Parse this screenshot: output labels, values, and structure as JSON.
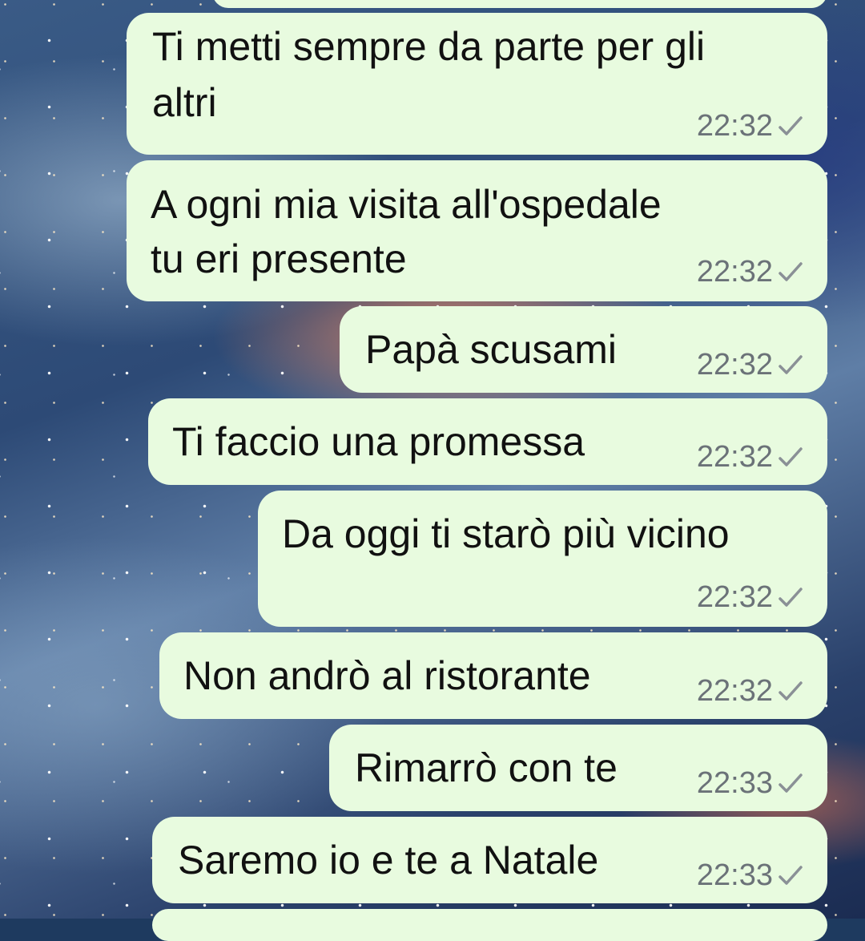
{
  "messages": [
    {
      "lines": [
        "",
        ""
      ],
      "time": "",
      "status_icon": "check-icon"
    },
    {
      "lines": [
        "Ti metti sempre da parte per gli",
        "altri"
      ],
      "time": "22:32",
      "status_icon": "check-icon"
    },
    {
      "lines": [
        "A ogni mia visita all'ospedale",
        "tu eri presente"
      ],
      "time": "22:32",
      "status_icon": "check-icon"
    },
    {
      "lines": [
        "Papà scusami"
      ],
      "time": "22:32",
      "status_icon": "check-icon"
    },
    {
      "lines": [
        "Ti faccio una promessa"
      ],
      "time": "22:32",
      "status_icon": "check-icon"
    },
    {
      "lines": [
        "Da oggi ti starò più vicino"
      ],
      "time": "22:32",
      "status_icon": "check-icon"
    },
    {
      "lines": [
        "Non andrò al ristorante"
      ],
      "time": "22:32",
      "status_icon": "check-icon"
    },
    {
      "lines": [
        "Rimarrò con te"
      ],
      "time": "22:33",
      "status_icon": "check-icon"
    },
    {
      "lines": [
        "Saremo io e te a Natale"
      ],
      "time": "22:33",
      "status_icon": "check-icon"
    }
  ],
  "colors": {
    "bubble": "#e8fbdf",
    "time": "#6b7278",
    "tick": "#8a9096"
  }
}
